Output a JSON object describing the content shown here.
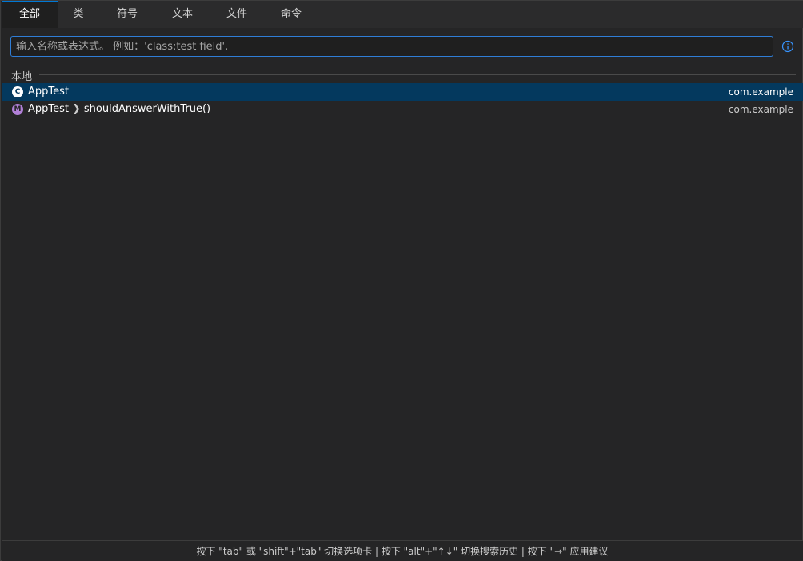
{
  "tabs": [
    {
      "label": "全部",
      "active": true
    },
    {
      "label": "类",
      "active": false
    },
    {
      "label": "符号",
      "active": false
    },
    {
      "label": "文本",
      "active": false
    },
    {
      "label": "文件",
      "active": false
    },
    {
      "label": "命令",
      "active": false
    }
  ],
  "search": {
    "placeholder": "输入名称或表达式。 例如：'class:test field'.",
    "value": ""
  },
  "info_icon": "info-icon",
  "section": {
    "label": "本地"
  },
  "results": [
    {
      "badge": "C",
      "kind": "class",
      "name": "AppTest",
      "member": "",
      "package": "com.example",
      "selected": true
    },
    {
      "badge": "M",
      "kind": "method",
      "name": "AppTest",
      "member": "shouldAnswerWithTrue()",
      "package": "com.example",
      "selected": false
    }
  ],
  "footer": {
    "hint": "按下 \"tab\" 或 \"shift\"+\"tab\" 切换选项卡 | 按下 \"alt\"+\"↑↓\" 切换搜索历史 | 按下 \"→\" 应用建议"
  },
  "colors": {
    "accent": "#0078d4",
    "selection": "#04395e",
    "background": "#252526",
    "method_badge": "#b180d7"
  }
}
